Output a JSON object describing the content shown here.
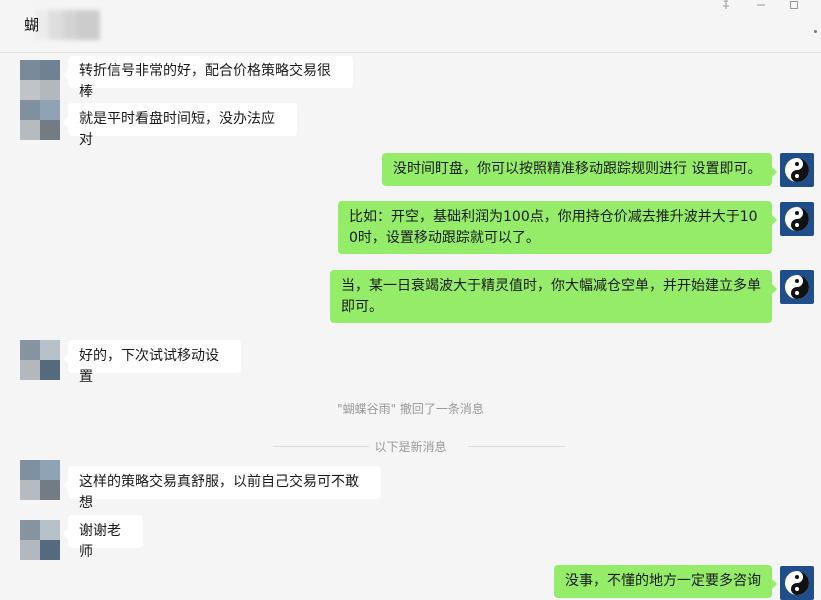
{
  "header": {
    "title": "蝴"
  },
  "messages": {
    "m1": "转折信号非常的好，配合价格策略交易很棒",
    "m2": "就是平时看盘时间短，没办法应对",
    "m3": "没时间盯盘，你可以按照精准移动跟踪规则进行 设置即可。",
    "m4": "比如：开空，基础利润为100点，你用持仓价减去推升波并大于100时，设置移动跟踪就可以了。",
    "m5": "当，某一日衰竭波大于精灵值时，你大幅减仓空单，并开始建立多单即可。",
    "m6": "好的，下次试试移动设置",
    "m7": "这样的策略交易真舒服，以前自己交易可不敢想",
    "m8": "谢谢老师",
    "m9": "没事，不懂的地方一定要多咨询"
  },
  "system": {
    "recall": "\"蝴蝶谷雨\" 撤回了一条消息",
    "new_messages": "以下是新消息"
  },
  "colors": {
    "outgoing_bubble": "#95ec69",
    "incoming_bubble": "#ffffff",
    "background": "#f5f5f5"
  },
  "icons": {
    "self_avatar": "yin-yang-icon"
  }
}
